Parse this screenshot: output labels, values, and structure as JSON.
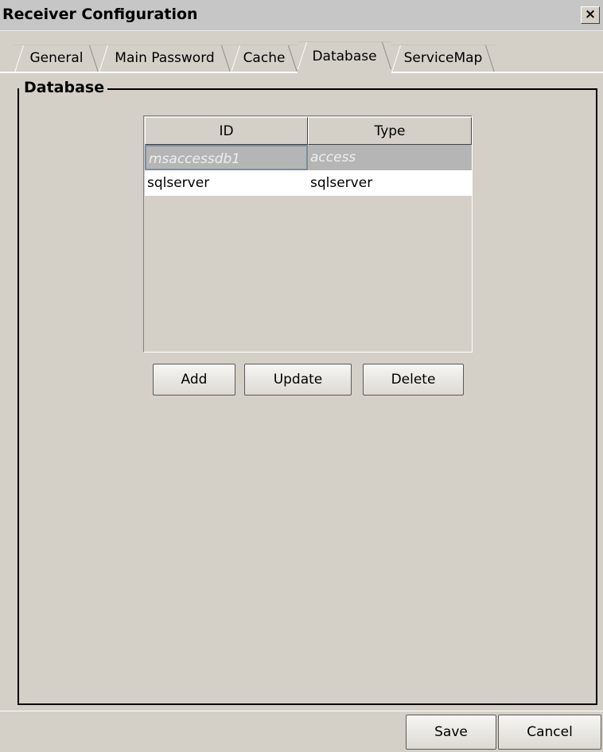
{
  "window": {
    "title": "Receiver Configuration",
    "close_glyph": "×"
  },
  "tabs": [
    {
      "label": "General",
      "active": false
    },
    {
      "label": "Main Password",
      "active": false
    },
    {
      "label": "Cache",
      "active": false
    },
    {
      "label": "Database",
      "active": true
    },
    {
      "label": "ServiceMap",
      "active": false
    }
  ],
  "group": {
    "title": "Database"
  },
  "table": {
    "columns": [
      "ID",
      "Type"
    ],
    "rows": [
      {
        "id": "msaccessdb1",
        "type": "access",
        "selected": true
      },
      {
        "id": "sqlserver",
        "type": "sqlserver",
        "selected": false
      }
    ]
  },
  "actions": {
    "add": "Add",
    "update": "Update",
    "delete": "Delete"
  },
  "footer": {
    "save": "Save",
    "cancel": "Cancel"
  },
  "icons": {
    "close": "close-icon"
  }
}
